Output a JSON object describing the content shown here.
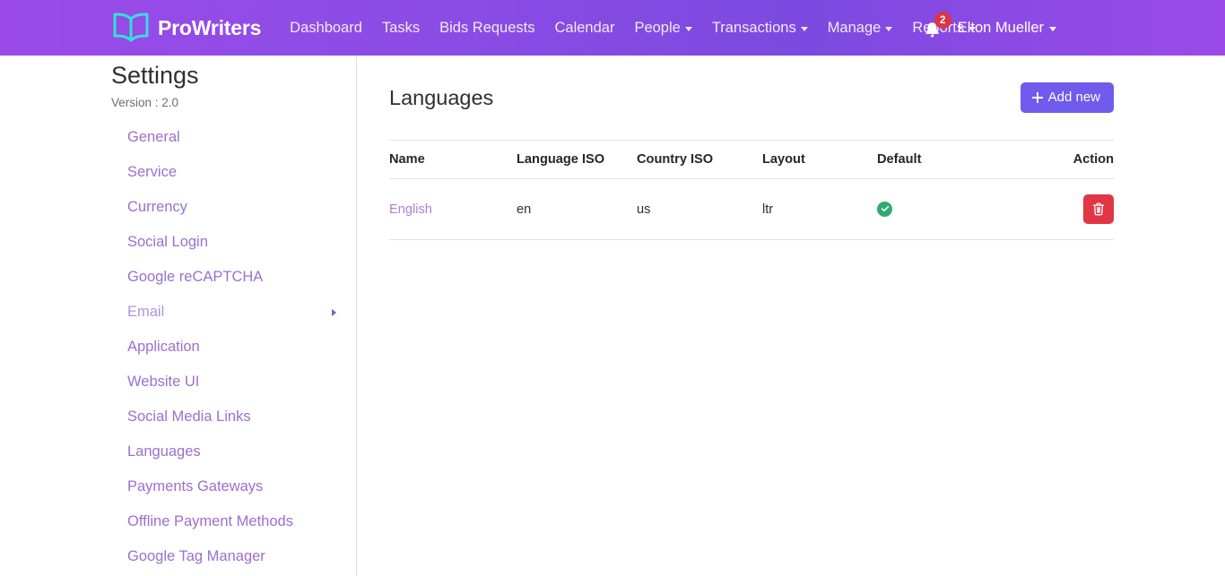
{
  "navbar": {
    "brand": "ProWriters",
    "links": [
      {
        "label": "Dashboard",
        "dropdown": false
      },
      {
        "label": "Tasks",
        "dropdown": false
      },
      {
        "label": "Bids Requests",
        "dropdown": false
      },
      {
        "label": "Calendar",
        "dropdown": false
      },
      {
        "label": "People",
        "dropdown": true
      },
      {
        "label": "Transactions",
        "dropdown": true
      },
      {
        "label": "Manage",
        "dropdown": true
      },
      {
        "label": "Reports",
        "dropdown": true
      }
    ],
    "notification_count": "2",
    "user_name": "Elton Mueller"
  },
  "sidebar": {
    "title": "Settings",
    "version": "Version : 2.0",
    "items": [
      {
        "label": "General",
        "submenu": false
      },
      {
        "label": "Service",
        "submenu": false
      },
      {
        "label": "Currency",
        "submenu": false
      },
      {
        "label": "Social Login",
        "submenu": false
      },
      {
        "label": "Google reCAPTCHA",
        "submenu": false
      },
      {
        "label": "Email",
        "submenu": true
      },
      {
        "label": "Application",
        "submenu": false
      },
      {
        "label": "Website UI",
        "submenu": false
      },
      {
        "label": "Social Media Links",
        "submenu": false
      },
      {
        "label": "Languages",
        "submenu": false
      },
      {
        "label": "Payments Gateways",
        "submenu": false
      },
      {
        "label": "Offline Payment Methods",
        "submenu": false
      },
      {
        "label": "Google Tag Manager",
        "submenu": false
      }
    ]
  },
  "main": {
    "title": "Languages",
    "add_button": "Add new",
    "table": {
      "headers": [
        "Name",
        "Language ISO",
        "Country ISO",
        "Layout",
        "Default",
        "Action"
      ],
      "rows": [
        {
          "name": "English",
          "language_iso": "en",
          "country_iso": "us",
          "layout": "ltr",
          "is_default": true
        }
      ]
    }
  },
  "colors": {
    "navbar_start": "#9b4ae8",
    "navbar_end": "#7c4ae0",
    "accent_purple": "#6f5bec",
    "link_purple": "#9b6fd1",
    "badge_red": "#dc3545",
    "delete_red": "#e23645",
    "success_green": "#2fab6e"
  }
}
